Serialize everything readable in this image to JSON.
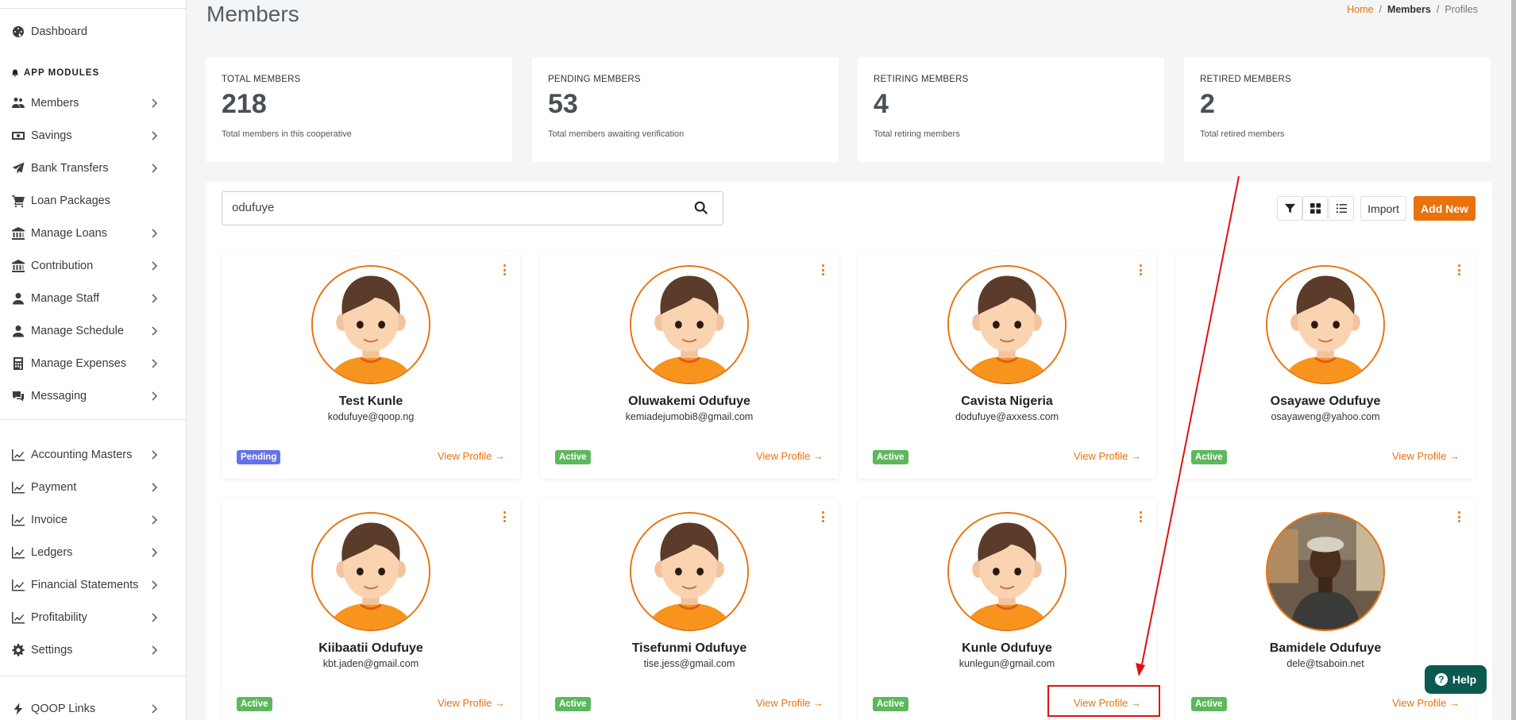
{
  "sidebar": {
    "dashboard": "Dashboard",
    "section_label": "APP MODULES",
    "items": [
      {
        "label": "Members",
        "icon": "users-icon",
        "chevron": true
      },
      {
        "label": "Savings",
        "icon": "money-icon",
        "chevron": true
      },
      {
        "label": "Bank Transfers",
        "icon": "paper-plane-icon",
        "chevron": true
      },
      {
        "label": "Loan Packages",
        "icon": "cart-icon",
        "chevron": false
      },
      {
        "label": "Manage Loans",
        "icon": "bank-icon",
        "chevron": true
      },
      {
        "label": "Contribution",
        "icon": "bank-icon",
        "chevron": true
      },
      {
        "label": "Manage Staff",
        "icon": "user-icon",
        "chevron": true
      },
      {
        "label": "Manage Schedule",
        "icon": "user-icon",
        "chevron": true
      },
      {
        "label": "Manage Expenses",
        "icon": "calculator-icon",
        "chevron": true
      },
      {
        "label": "Messaging",
        "icon": "comments-icon",
        "chevron": true
      }
    ],
    "items2": [
      {
        "label": "Accounting Masters",
        "icon": "chart-icon"
      },
      {
        "label": "Payment",
        "icon": "chart-icon"
      },
      {
        "label": "Invoice",
        "icon": "chart-icon"
      },
      {
        "label": "Ledgers",
        "icon": "chart-icon"
      },
      {
        "label": "Financial Statements",
        "icon": "chart-icon"
      },
      {
        "label": "Profitability",
        "icon": "chart-icon"
      },
      {
        "label": "Settings",
        "icon": "gear-icon"
      }
    ],
    "qoop_links": "QOOP Links"
  },
  "header": {
    "title": "Members",
    "breadcrumb": {
      "home": "Home",
      "sep": "/",
      "members": "Members",
      "profiles": "Profiles"
    }
  },
  "stats": [
    {
      "label": "TOTAL MEMBERS",
      "value": "218",
      "sub": "Total members in this cooperative"
    },
    {
      "label": "PENDING MEMBERS",
      "value": "53",
      "sub": "Total members awaiting verification"
    },
    {
      "label": "RETIRING MEMBERS",
      "value": "4",
      "sub": "Total retiring members"
    },
    {
      "label": "RETIRED MEMBERS",
      "value": "2",
      "sub": "Total retired members"
    }
  ],
  "search": {
    "value": "odufuye"
  },
  "toolbar": {
    "import": "Import",
    "add_new": "Add New"
  },
  "members": [
    {
      "name": "Test Kunle",
      "email": "kodufuye@qoop.ng",
      "status": "Pending",
      "view": "View Profile →",
      "photo": false
    },
    {
      "name": "Oluwakemi Odufuye",
      "email": "kemiadejumobi8@gmail.com",
      "status": "Active",
      "view": "View Profile →",
      "photo": false
    },
    {
      "name": "Cavista Nigeria",
      "email": "dodufuye@axxess.com",
      "status": "Active",
      "view": "View Profile →",
      "photo": false
    },
    {
      "name": "Osayawe Odufuye",
      "email": "osayaweng@yahoo.com",
      "status": "Active",
      "view": "View Profile →",
      "photo": false
    },
    {
      "name": "Kiibaatii Odufuye",
      "email": "kbt.jaden@gmail.com",
      "status": "Active",
      "view": "View Profile →",
      "photo": false
    },
    {
      "name": "Tisefunmi Odufuye",
      "email": "tise.jess@gmail.com",
      "status": "Active",
      "view": "View Profile →",
      "photo": false
    },
    {
      "name": "Kunle Odufuye",
      "email": "kunlegun@gmail.com",
      "status": "Active",
      "view": "View Profile →",
      "photo": false
    },
    {
      "name": "Bamidele Odufuye",
      "email": "dele@tsaboin.net",
      "status": "Active",
      "view": "View Profile →",
      "photo": true
    }
  ],
  "help": {
    "label": "Help"
  },
  "colors": {
    "accent": "#e8720c",
    "active": "#5cb85c",
    "pending": "#6571e8",
    "help": "#0b5a50",
    "annotation": "#e01010"
  }
}
